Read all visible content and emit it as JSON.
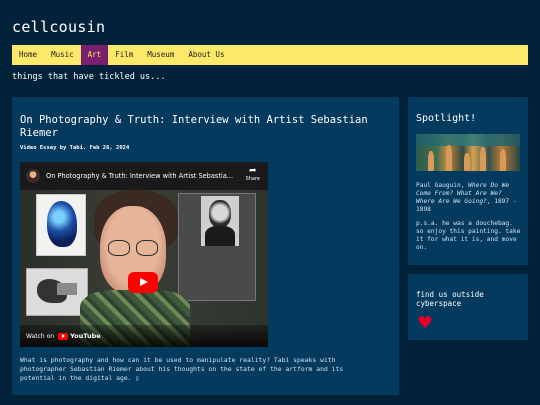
{
  "site": {
    "title": "cellcousin",
    "tagline": "things that have tickled us..."
  },
  "nav": {
    "items": [
      {
        "label": "Home",
        "active": false
      },
      {
        "label": "Music",
        "active": false
      },
      {
        "label": "Art",
        "active": true
      },
      {
        "label": "Film",
        "active": false
      },
      {
        "label": "Museum",
        "active": false
      },
      {
        "label": "About Us",
        "active": false
      }
    ]
  },
  "post": {
    "title": "On Photography & Truth: Interview with Artist Sebastian Riemer",
    "meta": "Video Essay by Tabi. Feb 26, 2024",
    "video": {
      "title": "On Photography & Truth: Interview with Artist Sebastia...",
      "share_label": "Share",
      "watch_on": "Watch on",
      "yt_label": "YouTube"
    },
    "excerpt": "What is photography and how can it be used to manipulate reality? Tabi speaks with photographer Sebastian Riemer about his thoughts on the state of the artform and its potential in the digital age. ▯"
  },
  "spotlight": {
    "title": "Spotlight!",
    "artist": "Paul Gauguin, ",
    "work": "Where Do We Come From? What Are We? Where Are We Going?",
    "years": ", 1897 - 1898",
    "note": "p.s.a. he was a douchebag. so enjoy this painting. take it for what it is, and move on."
  },
  "follow": {
    "title": "find us outside cyberspace",
    "icon": "heart-icon"
  },
  "colors": {
    "background": "#02223a",
    "card": "#053a5f",
    "nav_bg": "#fce96a",
    "nav_active": "#7a1f6f",
    "heart": "#e0002a"
  }
}
